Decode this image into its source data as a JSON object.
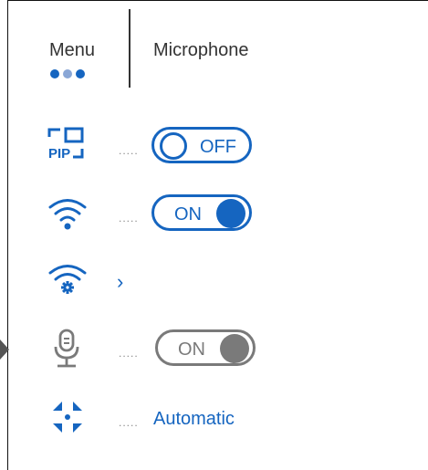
{
  "header": {
    "menu_label": "Menu",
    "title": "Microphone"
  },
  "colors": {
    "accent": "#1565c0",
    "inactive": "#7a7a7a",
    "dot_dark": "#1565c0",
    "dot_light": "#8aa7d6"
  },
  "rows": {
    "pip": {
      "icon": "pip-icon",
      "text": "PIP",
      "toggle": "OFF"
    },
    "wifi": {
      "icon": "wifi-icon",
      "toggle": "ON"
    },
    "wifi_settings": {
      "icon": "wifi-settings-icon",
      "chevron": "›"
    },
    "microphone": {
      "icon": "microphone-icon",
      "toggle": "ON"
    },
    "stabilization": {
      "icon": "auto-mode-icon",
      "value": "Automatic"
    }
  }
}
